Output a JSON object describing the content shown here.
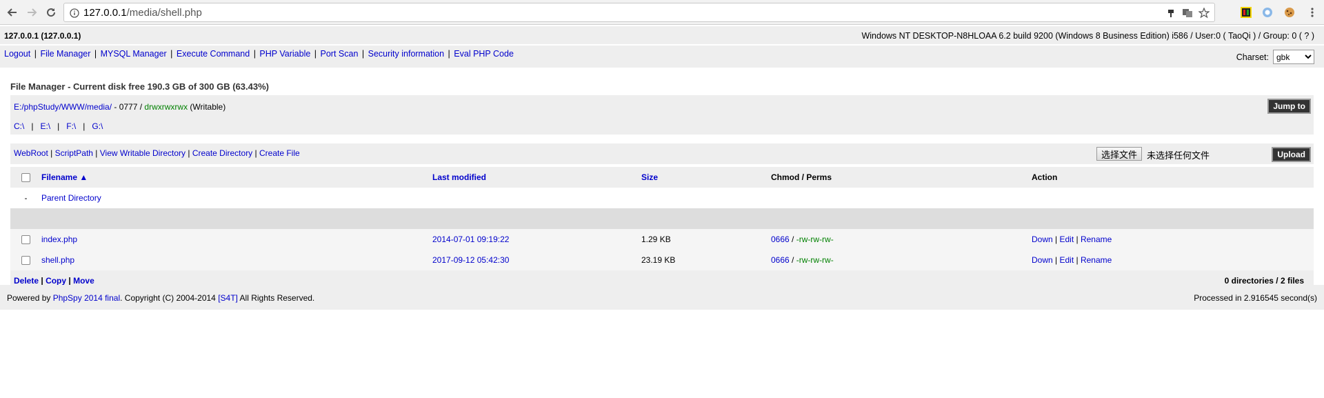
{
  "browser": {
    "url_host": "127.0.0.1",
    "url_path": "/media/shell.php"
  },
  "host": {
    "label": "127.0.0.1 (127.0.0.1)",
    "system_info": "Windows NT DESKTOP-N8HLOAA 6.2 build 9200 (Windows 8 Business Edition) i586 / User:0 ( TaoQi ) / Group: 0 ( ? )"
  },
  "menu": {
    "items": [
      "Logout",
      "File Manager",
      "MYSQL Manager",
      "Execute Command",
      "PHP Variable",
      "Port Scan",
      "Security information",
      "Eval PHP Code"
    ],
    "charset_label": "Charset:",
    "charset_value": "gbk"
  },
  "file_manager": {
    "title": "File Manager - Current disk free 190.3 GB of 300 GB (63.43%)",
    "path": "E:/phpStudy/WWW/media/",
    "mode": " - 0777 / ",
    "perms": "drwxrwxrwx",
    "writable": " (Writable)",
    "jump_button": "Jump to",
    "drives": [
      "C:\\",
      "E:\\",
      "F:\\",
      "G:\\"
    ]
  },
  "tools": {
    "links": [
      "WebRoot",
      "ScriptPath",
      "View Writable Directory",
      "Create Directory",
      "Create File"
    ],
    "choose_file": "选择文件",
    "no_file": "未选择任何文件",
    "upload_button": "Upload"
  },
  "table": {
    "headers": {
      "filename": "Filename ▲",
      "modified": "Last modified",
      "size": "Size",
      "chmod": "Chmod",
      "perms_sep": " / Perms",
      "action": "Action"
    },
    "parent": {
      "dash": "-",
      "label": "Parent Directory"
    },
    "rows": [
      {
        "name": "index.php",
        "modified": "2014-07-01 09:19:22",
        "size": "1.29 KB",
        "chmod": "0666",
        "perms": "-rw-rw-rw-",
        "down": "Down",
        "edit": "Edit",
        "rename": "Rename"
      },
      {
        "name": "shell.php",
        "modified": "2017-09-12 05:42:30",
        "size": "23.19 KB",
        "chmod": "0666",
        "perms": "-rw-rw-rw-",
        "down": "Down",
        "edit": "Edit",
        "rename": "Rename"
      }
    ],
    "bulk": {
      "delete": "Delete",
      "copy": "Copy",
      "move": "Move",
      "summary": "0 directories / 2 files"
    }
  },
  "footer": {
    "powered_prefix": "Powered by ",
    "powered_link": "PhpSpy 2014 final",
    "copyright": ". Copyright (C) 2004-2014 ",
    "s4t": "[S4T]",
    "rights": " All Rights Reserved.",
    "processed": "Processed in 2.916545 second(s)"
  }
}
